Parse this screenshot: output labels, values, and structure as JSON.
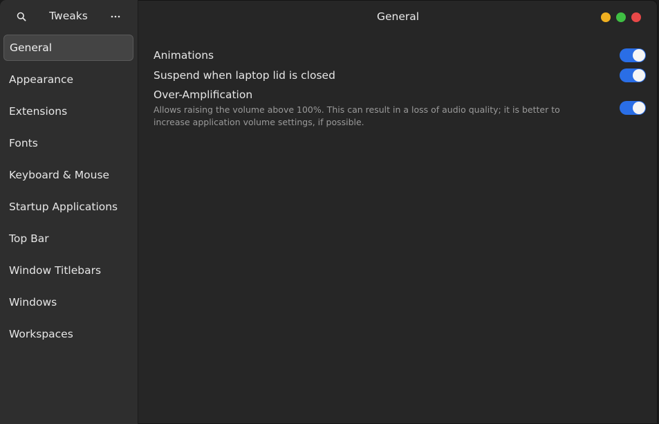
{
  "sidebar": {
    "title": "Tweaks",
    "search_icon": "search-icon",
    "menu_icon": "more-horizontal-icon",
    "items": [
      {
        "label": "General",
        "active": true
      },
      {
        "label": "Appearance"
      },
      {
        "label": "Extensions"
      },
      {
        "label": "Fonts"
      },
      {
        "label": "Keyboard & Mouse"
      },
      {
        "label": "Startup Applications"
      },
      {
        "label": "Top Bar"
      },
      {
        "label": "Window Titlebars"
      },
      {
        "label": "Windows"
      },
      {
        "label": "Workspaces"
      }
    ]
  },
  "header": {
    "title": "General",
    "window_controls": {
      "minimize_color": "#f0b020",
      "maximize_color": "#3fbf43",
      "close_color": "#e84848"
    }
  },
  "settings": [
    {
      "label": "Animations",
      "description": "",
      "enabled": true
    },
    {
      "label": "Suspend when laptop lid is closed",
      "description": "",
      "enabled": true
    },
    {
      "label": "Over-Amplification",
      "description": "Allows raising the volume above 100%. This can result in a loss of audio quality; it is better to increase application volume settings, if possible.",
      "enabled": true
    }
  ],
  "colors": {
    "accent": "#2a6ee6",
    "window_bg": "#262626",
    "sidebar_bg": "#2e2e2e"
  }
}
